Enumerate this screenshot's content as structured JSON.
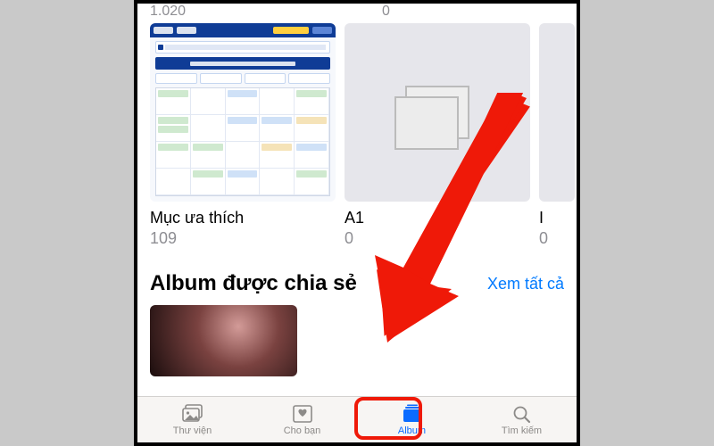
{
  "partial_row": {
    "left": "1.020",
    "right": "0"
  },
  "albums": [
    {
      "title": "Mục ưa thích",
      "count": "109"
    },
    {
      "title": "A1",
      "count": "0"
    },
    {
      "title": "I",
      "count": "0"
    }
  ],
  "shared_section": {
    "heading": "Album được chia sẻ",
    "see_all": "Xem tất cả"
  },
  "tabs": [
    {
      "label": "Thư viện"
    },
    {
      "label": "Cho bạn"
    },
    {
      "label": "Album"
    },
    {
      "label": "Tìm kiếm"
    }
  ],
  "colors": {
    "accent": "#007aff",
    "highlight": "#ef1908"
  }
}
